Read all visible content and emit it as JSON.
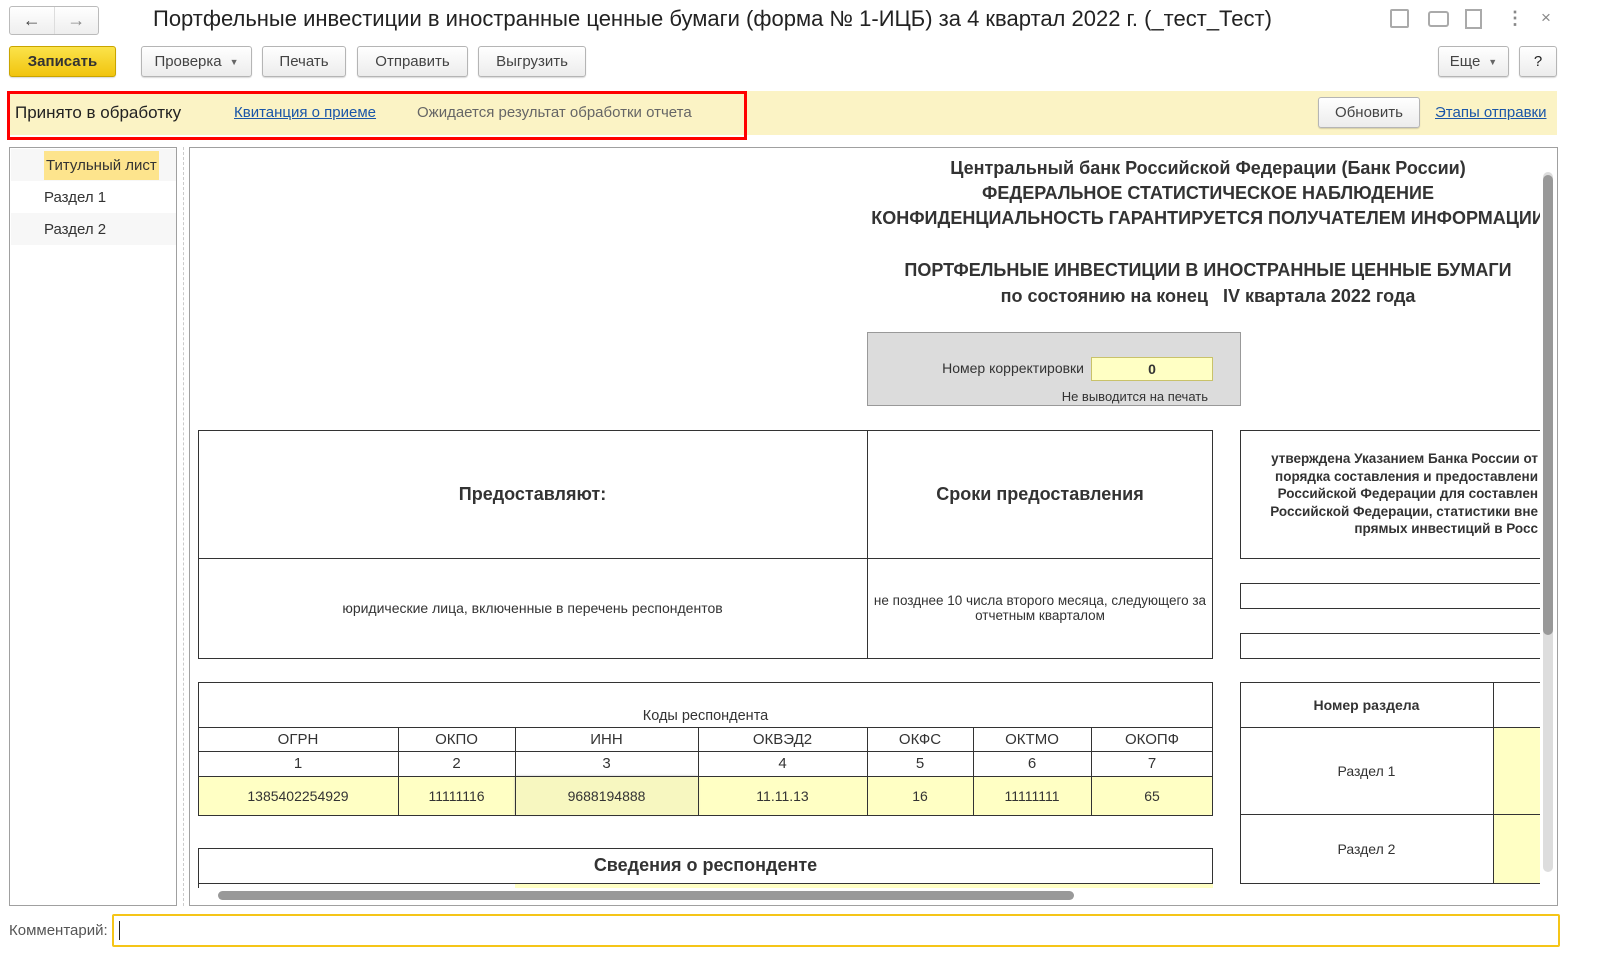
{
  "window": {
    "title": "Портфельные инвестиции в иностранные ценные бумаги (форма № 1-ИЦБ) за 4 квартал 2022 г. (_тест_Тест)"
  },
  "toolbar": {
    "save": "Записать",
    "check": "Проверка",
    "print": "Печать",
    "send": "Отправить",
    "export": "Выгрузить",
    "more": "Еще",
    "help": "?"
  },
  "status": {
    "state": "Принято в обработку",
    "receipt_link": "Квитанция о приеме",
    "message": "Ожидается результат обработки отчета",
    "refresh": "Обновить",
    "stages_link": "Этапы отправки",
    "highlight_color": "#ff0000",
    "bar_color": "#fbf3c5"
  },
  "sidebar": {
    "items": [
      {
        "label": "Титульный лист",
        "selected": true
      },
      {
        "label": "Раздел 1"
      },
      {
        "label": "Раздел 2"
      }
    ]
  },
  "doc": {
    "header": [
      "Центральный банк Российской Федерации (Банк России)",
      "ФЕДЕРАЛЬНОЕ СТАТИСТИЧЕСКОЕ НАБЛЮДЕНИЕ",
      "КОНФИДЕНЦИАЛЬНОСТЬ ГАРАНТИРУЕТСЯ ПОЛУЧАТЕЛЕМ ИНФОРМАЦИИ"
    ],
    "title": "ПОРТФЕЛЬНЫЕ ИНВЕСТИЦИИ В ИНОСТРАННЫЕ ЦЕННЫЕ БУМАГИ",
    "subtitle": "по состоянию на конец   IV квартала 2022 года",
    "correction": {
      "label": "Номер корректировки",
      "value": "0",
      "note": "Не выводится на печать"
    },
    "providers": {
      "h1": "Предоставляют:",
      "h2": "Сроки предоставления",
      "v1": "юридические лица, включенные в перечень респондентов",
      "v2": "не позднее 10 числа второго месяца, следующего за отчетным кварталом"
    },
    "approved": [
      "утверждена Указанием Банка России от",
      "порядка составления и предоставлени",
      "Российской Федерации для составлен",
      "Российской Федерации, статистики вне",
      "прямых инвестиций в Росс"
    ],
    "codes": {
      "title": "Коды респондента",
      "headers": [
        "ОГРН",
        "ОКПО",
        "ИНН",
        "ОКВЭД2",
        "ОКФС",
        "ОКТМО",
        "ОКОПФ"
      ],
      "numbers": [
        "1",
        "2",
        "3",
        "4",
        "5",
        "6",
        "7"
      ],
      "values": [
        "1385402254929",
        "11111116",
        "9688194888",
        "11.11.13",
        "16",
        "11111111",
        "65"
      ]
    },
    "sections": {
      "header": "Номер раздела",
      "rows": [
        "Раздел 1",
        "Раздел 2"
      ]
    },
    "respondent_title": "Сведения о респонденте"
  },
  "comment": {
    "label": "Комментарий:",
    "value": ""
  }
}
